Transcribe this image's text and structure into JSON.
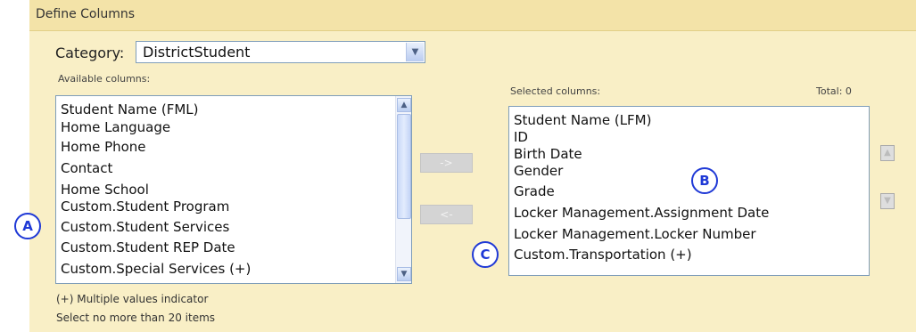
{
  "section": {
    "title": "Define Columns"
  },
  "category": {
    "label": "Category:",
    "value": "DistrictStudent"
  },
  "available": {
    "label": "Available columns:",
    "items": [
      "Student Name (FML)",
      "Home Language",
      "Home Phone",
      "Contact",
      "Home School",
      "Custom.Student Program",
      "Custom.Student Services",
      "Custom.Student REP Date",
      "Custom.Special Services (+)"
    ]
  },
  "selected": {
    "label": "Selected columns:",
    "total": "Total: 0",
    "items": [
      "Student Name (LFM)",
      "ID",
      "Birth Date",
      "Gender",
      "Grade",
      "Locker Management.Assignment Date",
      "Locker Management.Locker Number",
      "Custom.Transportation (+)"
    ]
  },
  "buttons": {
    "add": "->",
    "remove": "<-"
  },
  "notes": {
    "multiple": "(+) Multiple values indicator",
    "limit": "Select no more than 20 items"
  },
  "callouts": {
    "a": "A",
    "b": "B",
    "c": "C"
  },
  "icons": {
    "dropdown": "chevron-down-icon",
    "scroll_up": "scroll-up-icon",
    "scroll_down": "scroll-down-icon",
    "move_up": "move-up-icon",
    "move_down": "move-down-icon"
  },
  "colors": {
    "panel": "#f9efc6",
    "header": "#f3e3a8",
    "callout": "#1f39d6",
    "list_border": "#7f9db9"
  }
}
